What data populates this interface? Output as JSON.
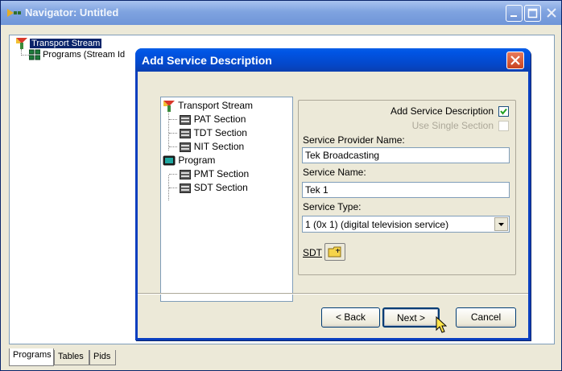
{
  "nav": {
    "title": "Navigator: Untitled",
    "tree": [
      {
        "label": "Transport Stream",
        "selected": true
      },
      {
        "label": "Programs (Stream Id"
      }
    ],
    "tabs": [
      "Programs",
      "Tables",
      "Pids"
    ]
  },
  "dialog": {
    "title": "Add Service Description",
    "tree": [
      {
        "label": "Transport Stream",
        "icon": "transport-stream-icon"
      },
      {
        "label": "PAT Section",
        "icon": "section-icon"
      },
      {
        "label": "TDT Section",
        "icon": "section-icon"
      },
      {
        "label": "NIT Section",
        "icon": "section-icon"
      },
      {
        "label": "Program",
        "icon": "program-icon"
      },
      {
        "label": "PMT Section",
        "icon": "section-icon"
      },
      {
        "label": "SDT Section",
        "icon": "section-icon"
      }
    ],
    "add_service_description": {
      "label": "Add Service Description",
      "checked": true
    },
    "use_single_section": {
      "label": "Use Single Section",
      "checked": false,
      "disabled": true
    },
    "service_provider_name": {
      "label": "Service Provider Name:",
      "value": "Tek Broadcasting"
    },
    "service_name": {
      "label": "Service Name:",
      "value": "Tek 1"
    },
    "service_type": {
      "label": "Service Type:",
      "value": "1 (0x 1) (digital television service)"
    },
    "sdt_label": "SDT",
    "buttons": {
      "back": "< Back",
      "next": "Next >",
      "cancel": "Cancel"
    }
  },
  "colors": {
    "accent": "#0a246a",
    "title_bar": "#0447c9",
    "close_red": "#c8431f"
  }
}
